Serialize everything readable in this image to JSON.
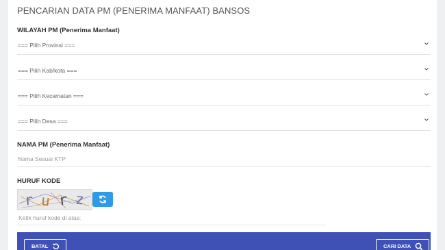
{
  "page": {
    "title": "PENCARIAN DATA PM (PENERIMA MANFAAT) BANSOS"
  },
  "wilayah": {
    "label": "WILAYAH PM (Penerima Manfaat)",
    "selects": [
      {
        "value": "=== Pilih Provinsi ==="
      },
      {
        "value": "=== Pilih Kab/kota ==="
      },
      {
        "value": "=== Pilih Kecamatan ==="
      },
      {
        "value": "=== Pilih Desa ==="
      }
    ]
  },
  "nama": {
    "label": "NAMA PM (Penerima Manfaat)",
    "placeholder": "Nama Sesuai KTP"
  },
  "captcha": {
    "label": "HURUF KODE",
    "code_text": "rurz",
    "placeholder": "Ketik huruf kode di atas:"
  },
  "buttons": {
    "cancel_label": "BATAL",
    "search_label": "CARI DATA"
  },
  "icons": {
    "chevron": "chevron-down-icon",
    "refresh": "refresh-icon",
    "undo": "undo-icon",
    "search": "search-icon"
  },
  "colors": {
    "footer_bar": "#3f51b5",
    "refresh_button": "#2f9be6"
  }
}
